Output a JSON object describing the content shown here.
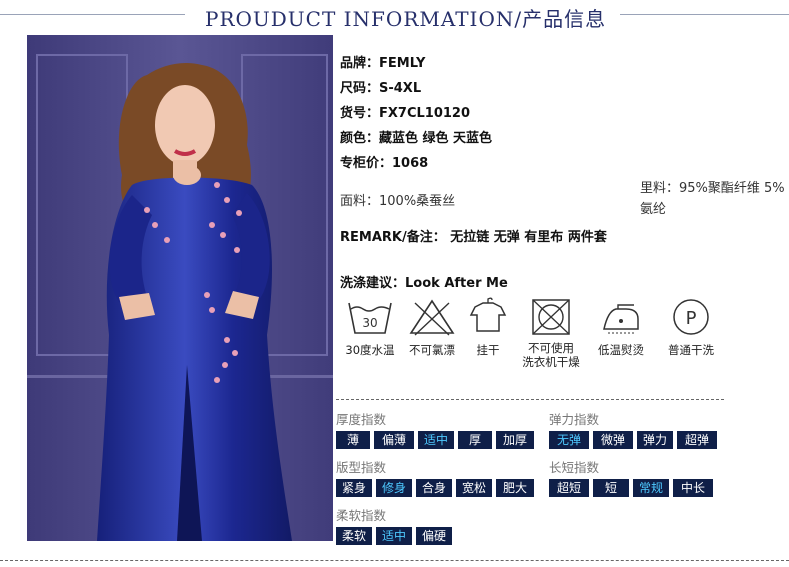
{
  "header": {
    "title": "PROUDUCT INFORMATION/产品信息"
  },
  "product": {
    "brand": "品牌：FEMLY",
    "size": "尺码：S-4XL",
    "sku": "货号：FX7CL10120",
    "colors": "颜色：藏蓝色 绿色 天蓝色",
    "price": "专柜价：1068",
    "fabric": "面料：100%桑蚕丝",
    "lining": "里料：95%聚酯纤维 5%氨纶",
    "remark": "REMARK/备注： 无拉链 无弹 有里布 两件套",
    "wash": "洗涤建议：Look After Me"
  },
  "care_icons": [
    {
      "icon": "wash-30-icon",
      "label": "30度水温",
      "number": "30"
    },
    {
      "icon": "no-bleach-icon",
      "label": "不可氯漂"
    },
    {
      "icon": "hang-dry-icon",
      "label": "挂干"
    },
    {
      "icon": "no-tumble-dry-icon",
      "label": "不可使用\n洗衣机干燥"
    },
    {
      "icon": "low-iron-icon",
      "label": "低温熨烫"
    },
    {
      "icon": "dry-clean-icon",
      "label": "普通干洗",
      "letter": "P"
    }
  ],
  "indices": {
    "thickness": {
      "title": "厚度指数",
      "options": [
        "薄",
        "偏薄",
        "适中",
        "厚",
        "加厚"
      ],
      "selected": "适中"
    },
    "elasticity": {
      "title": "弹力指数",
      "options": [
        "无弹",
        "微弹",
        "弹力",
        "超弹"
      ],
      "selected": "无弹"
    },
    "fit": {
      "title": "版型指数",
      "options": [
        "紧身",
        "修身",
        "合身",
        "宽松",
        "肥大"
      ],
      "selected": "修身"
    },
    "length": {
      "title": "长短指数",
      "options": [
        "超短",
        "短",
        "常规",
        "中长"
      ],
      "selected": "常规"
    },
    "softness": {
      "title": "柔软指数",
      "options": [
        "柔软",
        "适中",
        "偏硬"
      ],
      "selected": "适中"
    }
  },
  "colors": {
    "title": "#27306b",
    "tag_bg": "#0f1f48",
    "tag_selected_text": "#4ec9ff",
    "dress": "#1f2a8a"
  }
}
